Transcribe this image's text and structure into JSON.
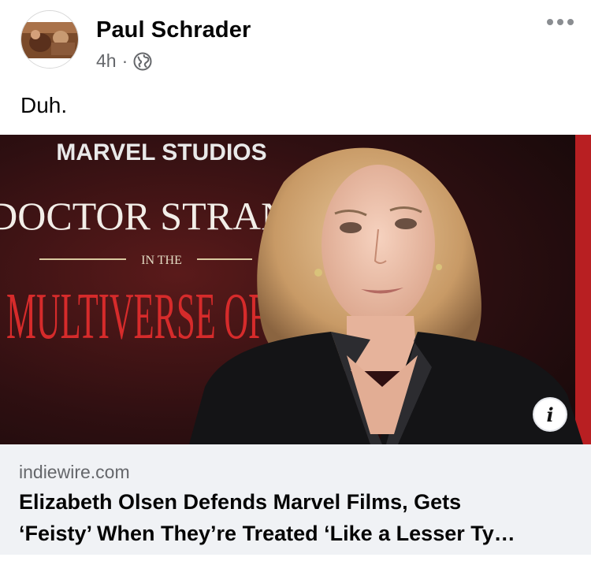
{
  "post": {
    "author": "Paul Schrader",
    "timestamp": "4h",
    "separator": "·",
    "privacy_icon": "globe-icon",
    "more_icon": "more-options-icon",
    "caption": "Duh."
  },
  "link_preview": {
    "image": {
      "backdrop_studio_text": "MARVEL STUDIOS",
      "backdrop_title_line1": "DOCTOR STRANGE",
      "backdrop_title_line2": "IN THE",
      "backdrop_title_line3": "MULTIVERSE OF MA"
    },
    "info_icon_glyph": "i",
    "domain": "indiewire.com",
    "headline_line1": "Elizabeth Olsen Defends Marvel Films, Gets",
    "headline_line2": "‘Feisty’ When They’re Treated ‘Like a Lesser Ty…"
  },
  "colors": {
    "name_text": "#050505",
    "secondary_text": "#65676b",
    "link_box_bg": "#f0f2f5",
    "backdrop_red": "#c81e1e"
  }
}
